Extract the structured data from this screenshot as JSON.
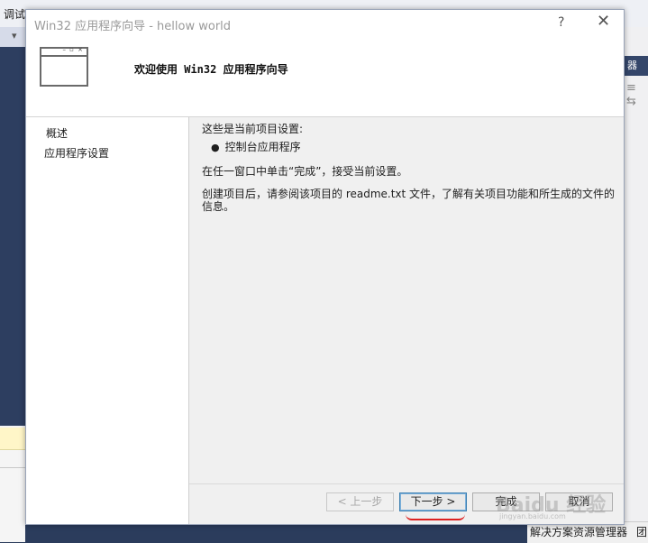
{
  "ide": {
    "menu_debug": "调试",
    "toolbar_chevron": "▾",
    "right_panel_header": "器",
    "right_panel_icons": "≡ ⇆",
    "status_solution": "解决方案资源管理器",
    "status_team": "团"
  },
  "dialog": {
    "title": "Win32 应用程序向导 - hellow world",
    "help": "?",
    "close": "✕",
    "header_title": "欢迎使用 Win32 应用程序向导",
    "sidebar": {
      "items": [
        {
          "label": "概述"
        },
        {
          "label": "应用程序设置"
        }
      ]
    },
    "content": {
      "line1": "这些是当前项目设置:",
      "bullet": "控制台应用程序",
      "line3": "在任一窗口中单击“完成”，接受当前设置。",
      "line4": "创建项目后，请参阅该项目的 readme.txt 文件，了解有关项目功能和所生成的文件的信息。"
    },
    "buttons": {
      "prev": "< 上一步",
      "next": "下一步 >",
      "finish": "完成",
      "cancel": "取消"
    },
    "watermark": "Baidu 经验",
    "watermark_sub": "jingyan.baidu.com"
  }
}
